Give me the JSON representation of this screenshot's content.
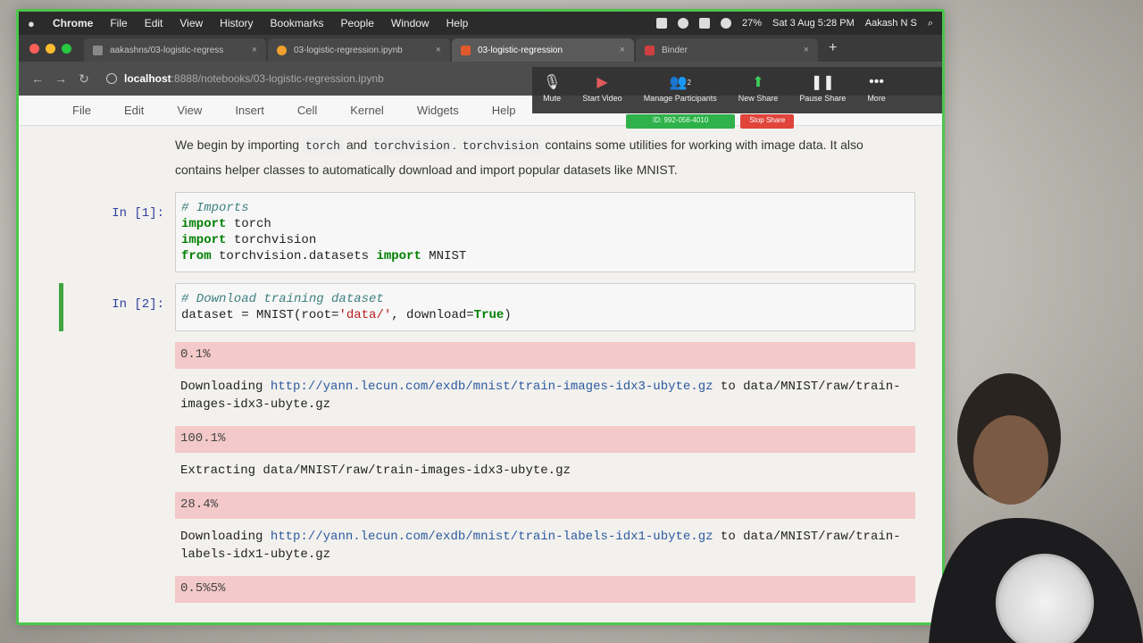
{
  "menubar": {
    "app": "Chrome",
    "items": [
      "File",
      "Edit",
      "View",
      "History",
      "Bookmarks",
      "People",
      "Window",
      "Help"
    ],
    "battery": "27%",
    "datetime": "Sat 3 Aug  5:28 PM",
    "user": "Aakash N S"
  },
  "tabs": [
    {
      "title": "aakashns/03-logistic-regress",
      "color": "#888888"
    },
    {
      "title": "03-logistic-regression.ipynb",
      "color": "#f0a030"
    },
    {
      "title": "03-logistic-regression",
      "color": "#e05a2b"
    },
    {
      "title": "Binder",
      "color": "#d04040"
    }
  ],
  "address": {
    "host": "localhost",
    "path": ":8888/notebooks/03-logistic-regression.ipynb"
  },
  "zoom": {
    "buttons": [
      "Mute",
      "Start Video",
      "Manage Participants",
      "New Share",
      "Pause Share",
      "More"
    ],
    "participants_count": "2",
    "meeting_id": "ID: 992-056-4010",
    "stop_share": "Stop Share"
  },
  "jupyter_menu": [
    "File",
    "Edit",
    "View",
    "Insert",
    "Cell",
    "Kernel",
    "Widgets",
    "Help"
  ],
  "markdown": {
    "p1": "We begin by importing",
    "code1": "torch",
    "and": "and",
    "code2": "torchvision",
    "dot": ".",
    "code3": "torchvision",
    "p2": "contains some utilities for working with image data. It also contains helper classes to automatically download and import popular datasets like MNIST."
  },
  "cell1": {
    "prompt": "In [1]:",
    "comment": "# Imports",
    "l2_kw": "import",
    "l2_rest": " torch",
    "l3_kw": "import",
    "l3_rest": " torchvision",
    "l4_kw1": "from",
    "l4_mid": " torchvision.datasets ",
    "l4_kw2": "import",
    "l4_rest": " MNIST"
  },
  "cell2": {
    "prompt": "In [2]:",
    "comment": "# Download training dataset",
    "l2_a": "dataset = MNIST(root=",
    "l2_str": "'data/'",
    "l2_b": ", download=",
    "l2_true": "True",
    "l2_c": ")"
  },
  "outputs": {
    "p1": "0.1%",
    "dl1_prefix": "Downloading ",
    "dl1_url": "http://yann.lecun.com/exdb/mnist/train-images-idx3-ubyte.gz",
    "dl1_suffix": " to data/MNIST/raw/train-images-idx3-ubyte.gz",
    "p2": "100.1%",
    "ex1": "Extracting data/MNIST/raw/train-images-idx3-ubyte.gz",
    "p3": "28.4%",
    "dl2_prefix": "Downloading ",
    "dl2_url": "http://yann.lecun.com/exdb/mnist/train-labels-idx1-ubyte.gz",
    "dl2_suffix": " to data/MNIST/raw/train-labels-idx1-ubyte.gz",
    "p4": "0.5%5%"
  }
}
